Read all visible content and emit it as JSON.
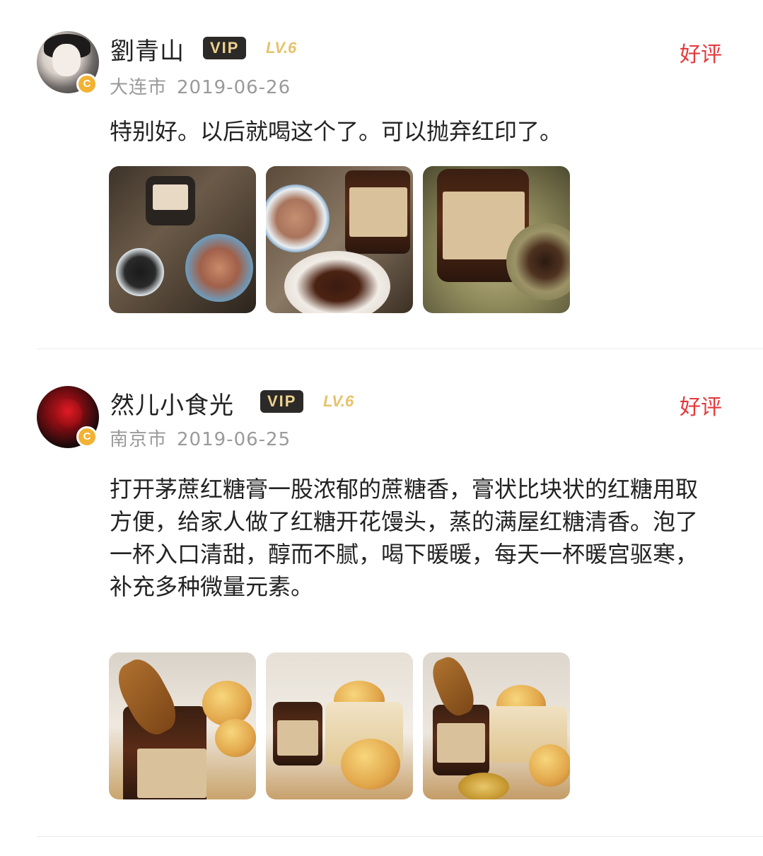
{
  "reviews": [
    {
      "username": "劉青山",
      "vip_label": "VIP",
      "level": "LV.6",
      "badge": "C",
      "city": "大连市",
      "date": "2019-06-26",
      "rating": "好评",
      "content": "特别好。以后就喝这个了。可以抛弃红印了。",
      "photo_count": 3
    },
    {
      "username": "然儿小食光",
      "vip_label": "VIP",
      "level": "LV.6",
      "badge": "C",
      "city": "南京市",
      "date": "2019-06-25",
      "rating": "好评",
      "content": "打开茅蔗红糖膏一股浓郁的蔗糖香，膏状比块状的红糖用取方便，给家人做了红糖开花馒头，蒸的满屋红糖清香。泡了一杯入口清甜，醇而不腻，喝下暖暖，每天一杯暖宫驱寒，补充多种微量元素。",
      "photo_count": 3
    }
  ],
  "colors": {
    "rating": "#e4393c",
    "vip_bg": "#2b2a28",
    "vip_text": "#f0d28f",
    "level": "#e6c26a",
    "meta": "#9a9a9a",
    "badge": "#f2b233"
  }
}
